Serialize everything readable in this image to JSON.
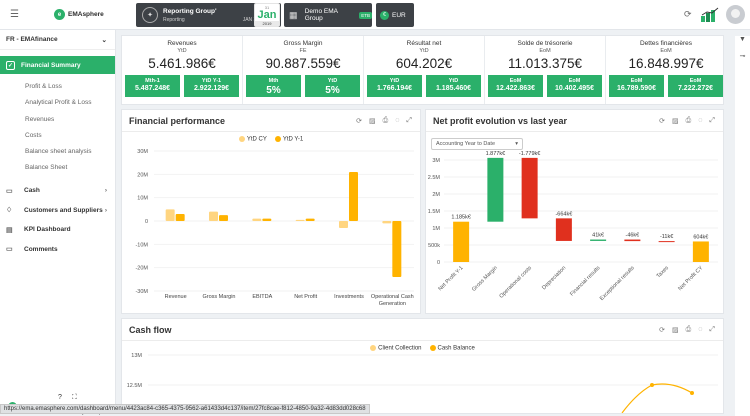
{
  "topbar": {
    "app_name": "EMAsphere",
    "reporting_title": "Reporting Group'",
    "reporting_sub": "Reporting",
    "reporting_date": "JAN 31, 2019",
    "cal_day": "31",
    "cal_month": "Jan",
    "cal_year": "2019",
    "group_name": "Demo EMA Group",
    "group_badge": "ETB",
    "currency": "EUR",
    "currency_symbol": "€"
  },
  "sidebar": {
    "company": "FR - EMAfinance",
    "selected": "Financial Summary",
    "subitems": [
      "Profit & Loss",
      "Analytical Profit & Loss",
      "Revenues",
      "Costs",
      "Balance sheet analysis",
      "Balance Sheet"
    ],
    "main_items": [
      "Cash",
      "Customers and Suppliers",
      "KPI Dashboard",
      "Comments"
    ],
    "powered": "Powered by EMAsphere",
    "help": "?"
  },
  "kpis": [
    {
      "title": "Revenues",
      "sub": "YtD",
      "value": "5.461.986€",
      "b1l": "Mth-1",
      "b1v": "5.487.248€",
      "b2l": "YtD Y-1",
      "b2v": "2.922.129€",
      "big": false
    },
    {
      "title": "Gross Margin",
      "sub": "FE",
      "value": "90.887.559€",
      "b1l": "Mth",
      "b1v": "5%",
      "b2l": "YtD",
      "b2v": "5%",
      "big": true
    },
    {
      "title": "Résultat net",
      "sub": "YtD",
      "value": "604.202€",
      "b1l": "YtD",
      "b1v": "1.766.194€",
      "b2l": "YtD",
      "b2v": "1.185.460€",
      "big": false
    },
    {
      "title": "Solde de trésorerie",
      "sub": "EoM",
      "value": "11.013.375€",
      "b1l": "EoM",
      "b1v": "12.422.863€",
      "b2l": "EoM",
      "b2v": "10.402.495€",
      "big": false
    },
    {
      "title": "Dettes financières",
      "sub": "EoM",
      "value": "16.848.997€",
      "b1l": "EoM",
      "b1v": "16.789.590€",
      "b2l": "EoM",
      "b2v": "7.222.272€",
      "big": false
    }
  ],
  "financial_performance": {
    "title": "Financial performance",
    "legend": [
      "YtD CY",
      "YtD Y-1"
    ]
  },
  "net_profit": {
    "title": "Net profit evolution vs last year",
    "dropdown": "Accounting Year to Date"
  },
  "cash_flow": {
    "title": "Cash flow",
    "legend": [
      "Client Collection",
      "Cash Balance"
    ]
  },
  "status_url": "https://ema.emasphere.com/dashboard/menu/4423ac84-c365-4375-9562-a61433d4c137/item/27fc8cae-f812-4850-9a32-4d83dd028c68",
  "colors": {
    "green": "#2bb06a",
    "orange": "#ffb300",
    "light_orange": "#ffd580",
    "red": "#e0301e",
    "dark": "#3d4146"
  },
  "chart_data": [
    {
      "type": "bar",
      "title": "Financial performance",
      "categories": [
        "Revenue",
        "Gross Margin",
        "EBITDA",
        "Net Profit",
        "Investments",
        "Operational Cash Generation"
      ],
      "series": [
        {
          "name": "YtD CY",
          "values": [
            5,
            4,
            1,
            0.5,
            -3,
            -1
          ]
        },
        {
          "name": "YtD Y-1",
          "values": [
            3,
            2.5,
            1,
            1,
            21,
            -24
          ]
        }
      ],
      "ylim": [
        -30,
        30
      ],
      "yticks": [
        "30M",
        "25M",
        "20M",
        "15M",
        "10M",
        "5M",
        "0",
        "-5M",
        "-10M",
        "-15M",
        "-20M",
        "-25M",
        "-30M"
      ]
    },
    {
      "type": "bar",
      "title": "Net profit evolution vs last year",
      "categories": [
        "Net Profit Y-1",
        "Gross Margin",
        "Operational costs",
        "Depreciation",
        "Financial results",
        "Exceptional results",
        "Taxes",
        "Net Profit CY"
      ],
      "values": [
        1185460,
        1877000,
        -1779000,
        -664000,
        41000,
        -46000,
        -11000,
        604000
      ],
      "labels": [
        "1.185k€",
        "1.877k€",
        "-1.779k€",
        "-664k€",
        "41k€",
        "-46k€",
        "-11k€",
        "604k€"
      ],
      "yticks": [
        "3M",
        "2.5M",
        "2M",
        "1.5M",
        "1M",
        "500k",
        "0"
      ],
      "ylim": [
        0,
        3
      ]
    },
    {
      "type": "line",
      "title": "Cash flow",
      "series": [
        {
          "name": "Client Collection"
        },
        {
          "name": "Cash Balance"
        }
      ],
      "yticks": [
        "13M",
        "12.5M",
        "12M"
      ]
    }
  ]
}
